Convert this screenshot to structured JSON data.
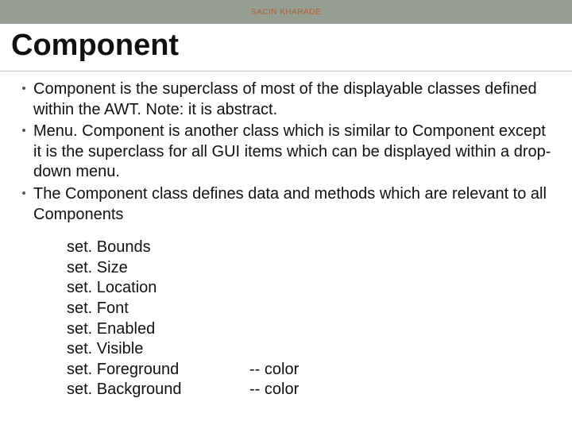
{
  "header": {
    "author": "SACIN KHARADE"
  },
  "title": "Component",
  "bullets": {
    "b1": "Component is the superclass of most of the displayable classes defined within the AWT.  Note: it is abstract.",
    "b2": "Menu. Component is another class which is similar to Component except it is the superclass for all GUI items which can be displayed within a drop-down menu.",
    "b3": "The Component class defines data and methods which are relevant to all Components"
  },
  "methods": [
    {
      "name": "set. Bounds",
      "note": ""
    },
    {
      "name": "set. Size",
      "note": ""
    },
    {
      "name": "set. Location",
      "note": ""
    },
    {
      "name": "set. Font",
      "note": ""
    },
    {
      "name": "set. Enabled",
      "note": ""
    },
    {
      "name": "set. Visible",
      "note": ""
    },
    {
      "name": "set. Foreground",
      "note": "-- color"
    },
    {
      "name": "set. Background",
      "note": "-- color"
    }
  ]
}
